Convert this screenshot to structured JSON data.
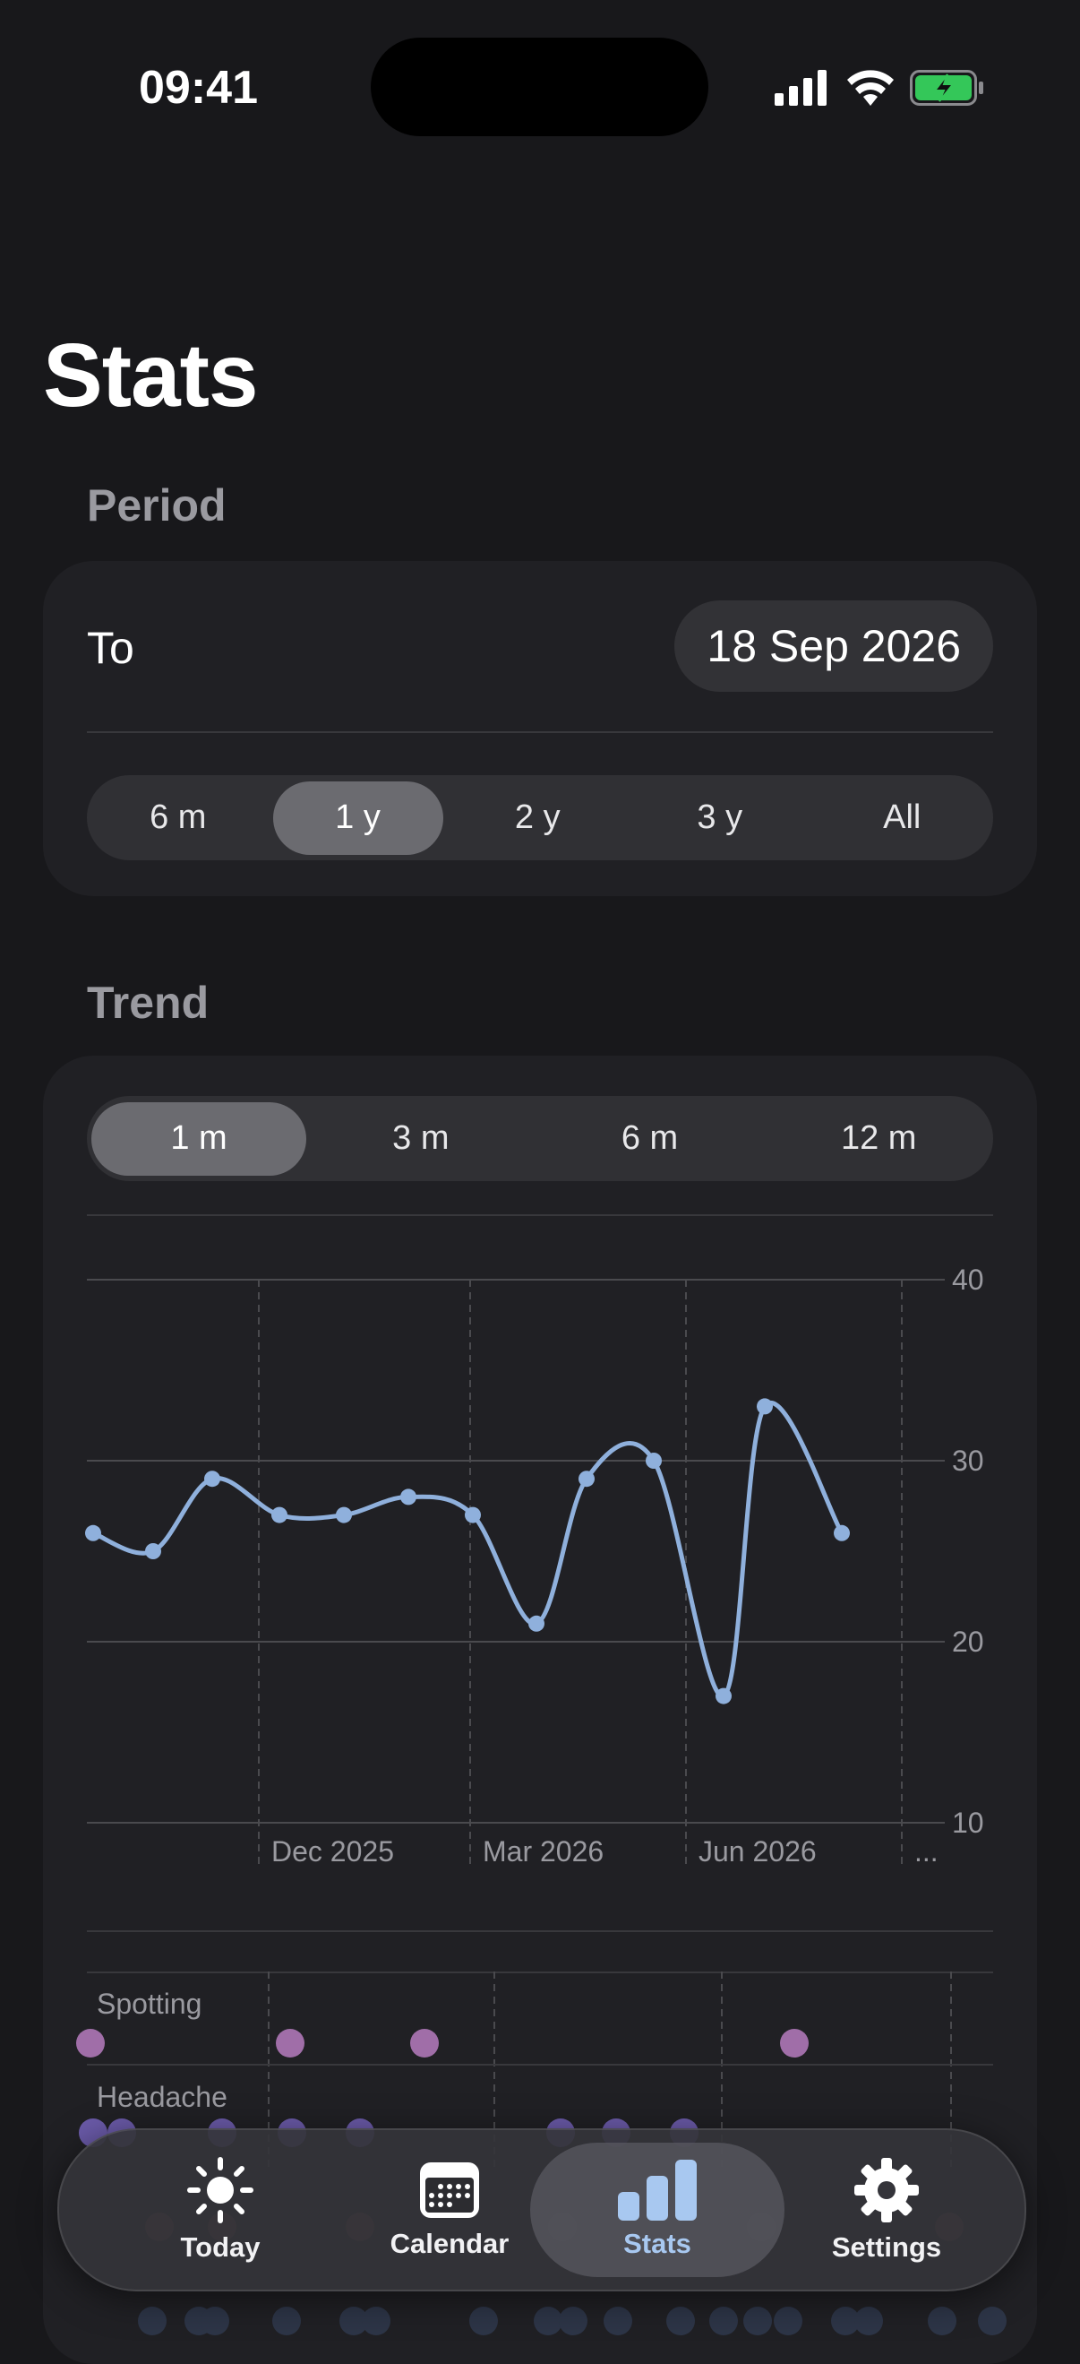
{
  "status_bar": {
    "time": "09:41"
  },
  "page": {
    "title": "Stats"
  },
  "period": {
    "label": "Period",
    "to_label": "To",
    "date": "18 Sep 2026",
    "options": [
      "6 m",
      "1 y",
      "2 y",
      "3 y",
      "All"
    ],
    "selected": "1 y"
  },
  "trend": {
    "label": "Trend",
    "options": [
      "1 m",
      "3 m",
      "6 m",
      "12 m"
    ],
    "selected": "1 m"
  },
  "chart_data": {
    "type": "line",
    "x_tick_labels": [
      "Dec 2025",
      "Mar 2026",
      "Jun 2026",
      "..."
    ],
    "y_ticks": [
      10,
      20,
      30,
      40
    ],
    "ylim": [
      10,
      40
    ],
    "grid": true,
    "y_axis_side": "right",
    "line_color": "#8fb0dc",
    "series": [
      {
        "values": [
          26,
          25,
          29,
          27,
          27,
          28,
          27,
          21,
          29,
          30,
          17,
          33,
          26
        ]
      }
    ]
  },
  "symptoms": {
    "spotting_label": "Spotting",
    "headache_label": "Headache",
    "spotting_color": "#a06ea8",
    "headache_color": "#6a5aa8"
  },
  "tabbar": {
    "tabs": [
      {
        "label": "Today",
        "icon": "sun-icon"
      },
      {
        "label": "Calendar",
        "icon": "calendar-icon"
      },
      {
        "label": "Stats",
        "icon": "bar-chart-icon"
      },
      {
        "label": "Settings",
        "icon": "gear-icon"
      }
    ],
    "active": "Stats",
    "active_color": "#a8c8f0"
  }
}
